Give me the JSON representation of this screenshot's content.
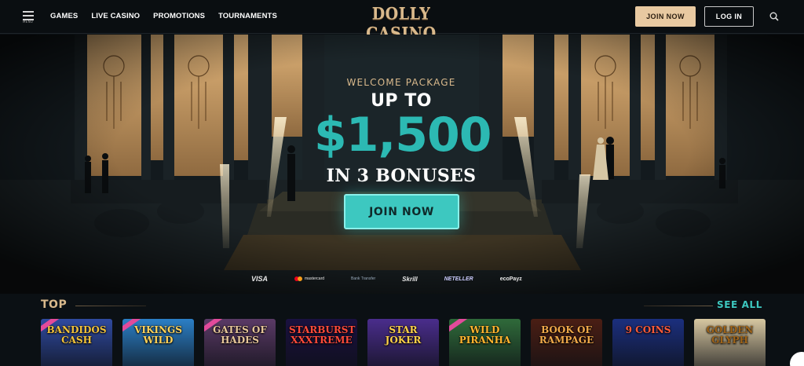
{
  "header": {
    "menu_caption": "MENU",
    "nav": [
      "GAMES",
      "LIVE CASINO",
      "PROMOTIONS",
      "TOURNAMENTS"
    ],
    "logo": "DOLLY CASINO",
    "join_label": "JOIN NOW",
    "login_label": "LOG IN"
  },
  "hero": {
    "welcome": "WELCOME PACKAGE",
    "up_to": "UP TO",
    "amount": "$1,500",
    "bonuses": "IN 3 BONUSES",
    "cta": "JOIN NOW"
  },
  "payments": [
    "VISA",
    "mastercard",
    "Bank Transfer",
    "Skrill",
    "NETELLER",
    "ecoPayz"
  ],
  "top": {
    "label": "TOP",
    "see_all": "SEE ALL"
  },
  "games": [
    {
      "title": "BANDIDOS CASH",
      "bg": "#2f4aa0",
      "fg": "#f3c33b",
      "badge": true
    },
    {
      "title": "VIKINGS WILD",
      "bg": "#2b7fc6",
      "fg": "#ffd35a",
      "badge": true
    },
    {
      "title": "GATES OF HADES",
      "bg": "#5a3a66",
      "fg": "#e8c79a",
      "badge": true
    },
    {
      "title": "STARBURST XXXTREME",
      "bg": "#1a1140",
      "fg": "#ff4a3a",
      "badge": false
    },
    {
      "title": "STAR JOKER",
      "bg": "#4a2d8c",
      "fg": "#ffd24a",
      "badge": false
    },
    {
      "title": "WILD PIRANHA",
      "bg": "#2f6a3a",
      "fg": "#ffb52e",
      "badge": true
    },
    {
      "title": "BOOK OF RAMPAGE",
      "bg": "#4a1e14",
      "fg": "#f0a94a",
      "badge": false
    },
    {
      "title": "9 COINS",
      "bg": "#1b2f7e",
      "fg": "#ff5b3a",
      "badge": false
    },
    {
      "title": "GOLDEN GLYPH",
      "bg": "#d7c7a1",
      "fg": "#a06418",
      "badge": false
    }
  ],
  "colors": {
    "accent_gold": "#d9b98c",
    "accent_teal": "#3dc8c0",
    "background": "#0b1014"
  }
}
